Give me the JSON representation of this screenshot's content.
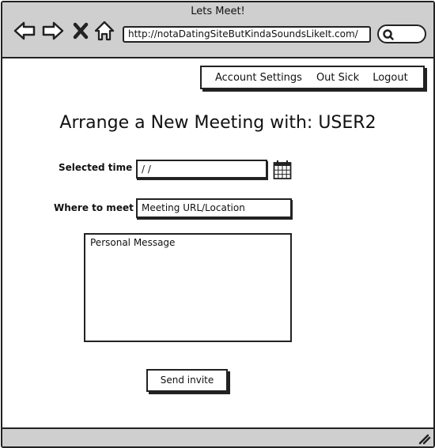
{
  "window": {
    "title": "Lets Meet!"
  },
  "browser": {
    "url": "http://notaDatingSiteButKindaSoundsLikeIt.com/",
    "icons": [
      "back-arrow-icon",
      "forward-arrow-icon",
      "close-x-icon",
      "home-icon",
      "search-icon"
    ]
  },
  "menu": {
    "account_settings": "Account Settings",
    "out_sick": "Out Sick",
    "logout": "Logout"
  },
  "page": {
    "heading": "Arrange a New Meeting with: USER2"
  },
  "form": {
    "time_label": "Selected time",
    "time_value": " /  /",
    "calendar_icon": "calendar-icon",
    "location_label": "Where to meet",
    "location_value": "Meeting URL/Location",
    "message_value": "Personal Message",
    "send_label": "Send invite"
  }
}
